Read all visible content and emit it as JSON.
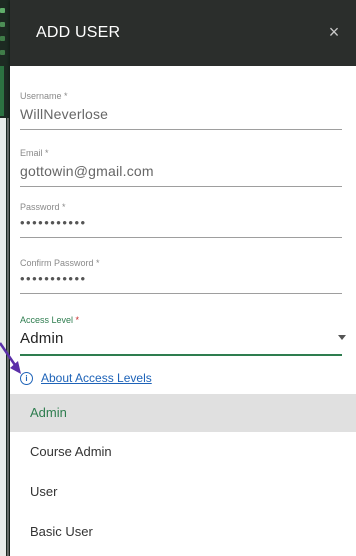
{
  "dialog": {
    "title": "ADD USER",
    "close_symbol": "×"
  },
  "fields": {
    "username": {
      "label": "Username",
      "required_mark": "*",
      "value": "WillNeverlose"
    },
    "email": {
      "label": "Email",
      "required_mark": "*",
      "value": "gottowin@gmail.com"
    },
    "password": {
      "label": "Password",
      "required_mark": "*",
      "value": "•••••••••••"
    },
    "confirm_password": {
      "label": "Confirm Password",
      "required_mark": "*",
      "value": "•••••••••••"
    },
    "access_level": {
      "label": "Access Level",
      "required_mark": "*",
      "value": "Admin"
    }
  },
  "about_link": {
    "icon": "info-icon",
    "text": "About Access Levels"
  },
  "access_options": [
    "Admin",
    "Course Admin",
    "User",
    "Basic User"
  ],
  "colors": {
    "header_bg": "#2b2e2c",
    "accent_green": "#2e7d4f",
    "link_blue": "#1e63b8",
    "required_red": "#c62828",
    "arrow_purple": "#5b2fa8"
  }
}
